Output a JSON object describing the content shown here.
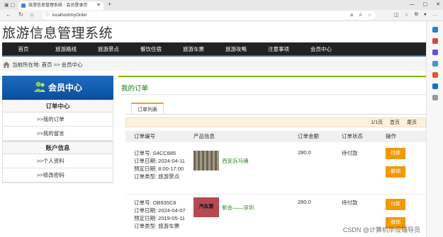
{
  "browser": {
    "tab_title": "旅游信息管理系统 - 会员登录页",
    "address": "localhost/myOrder"
  },
  "site": {
    "title": "旅游信息管理系统",
    "nav": [
      "首页",
      "旅游路线",
      "旅游景点",
      "餐饮住宿",
      "旅游车票",
      "旅游攻略",
      "注意事项",
      "会员中心"
    ],
    "breadcrumb": "当前所在地:  首页 >> 会员中心"
  },
  "sidebar": {
    "banner": "会员中心",
    "groups": [
      {
        "title": "订单中心",
        "items": [
          ">>我的订单",
          ">>我的留言"
        ]
      },
      {
        "title": "账户信息",
        "items": [
          ">>个人资料",
          ">>修改密码"
        ]
      }
    ]
  },
  "orders": {
    "title": "我的订单",
    "tab": "订单列表",
    "pager": {
      "info": "1/1页",
      "first": "首页",
      "last": "尾页"
    },
    "columns": [
      "订单编号",
      "产品信息",
      "订单金额",
      "订单状态",
      "操作"
    ],
    "rows": [
      {
        "no": "订单号:  S4CC885",
        "date": "订单日期:  2024-04-11",
        "plan": "预定日期:  8:00-17:00",
        "type": "订单类型:  旅游景点",
        "product": "西安兵马俑",
        "thumb_color": "#8a8270",
        "amount": "280.0",
        "status": "待付款",
        "pay": "付款",
        "cancel": "撤销"
      },
      {
        "no": "订单号:  OB935C6",
        "date": "订单日期:  2024-04-07",
        "plan": "预定日期:  2019-05-11",
        "type": "订单类型:  旅游车票",
        "product": "新会——深圳",
        "thumb_color": "#b54a52",
        "thumb_text": "汽车票",
        "amount": "280.0",
        "status": "待付款",
        "pay": "付款",
        "cancel": "撤销"
      }
    ]
  },
  "watermark": "CSDN @计算机毕设辅导员"
}
